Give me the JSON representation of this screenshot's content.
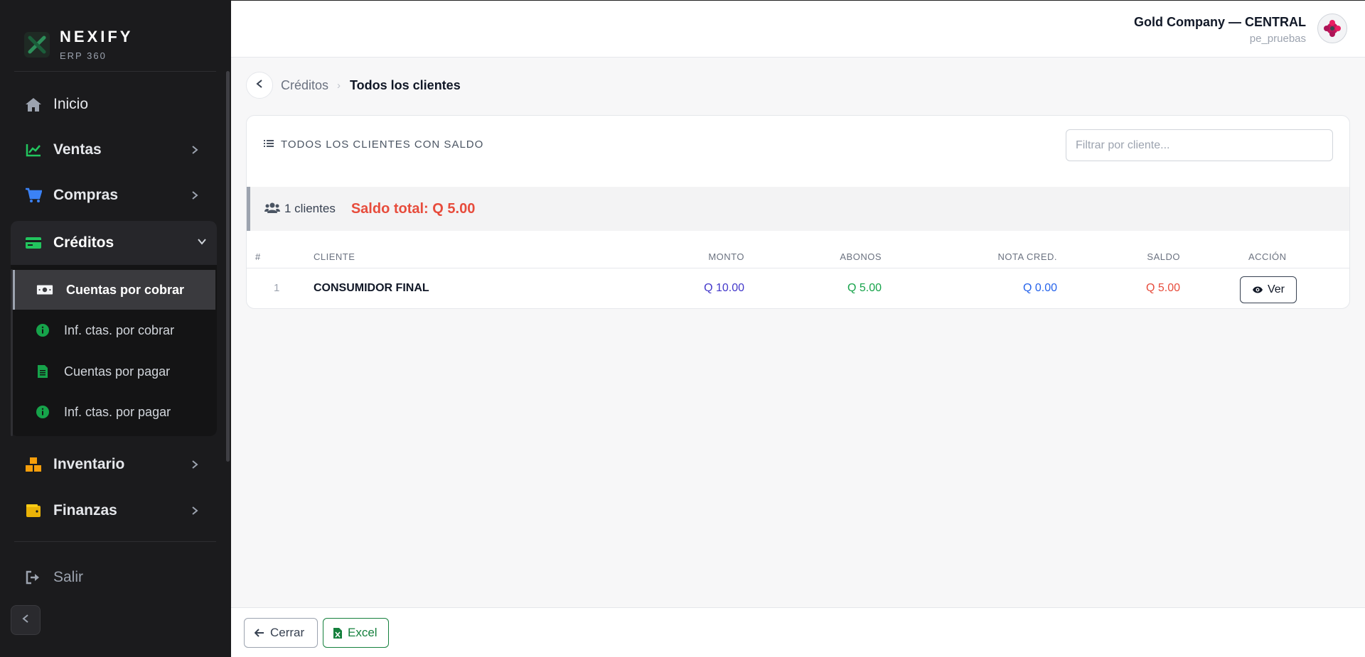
{
  "brand": {
    "name": "NEXIFY",
    "sub": "ERP 360"
  },
  "sidebar": {
    "items": [
      {
        "label": "Inicio",
        "icon": "home-icon"
      },
      {
        "label": "Ventas",
        "icon": "chart-line-icon"
      },
      {
        "label": "Compras",
        "icon": "cart-icon"
      },
      {
        "label": "Créditos",
        "icon": "credit-card-icon"
      },
      {
        "label": "Inventario",
        "icon": "boxes-icon"
      },
      {
        "label": "Finanzas",
        "icon": "wallet-icon"
      }
    ],
    "credits_sub": [
      {
        "label": "Cuentas por cobrar",
        "icon": "money-bill-icon",
        "active": true
      },
      {
        "label": "Inf. ctas. por cobrar",
        "icon": "info-circle-icon"
      },
      {
        "label": "Cuentas por pagar",
        "icon": "file-invoice-icon"
      },
      {
        "label": "Inf. ctas. por pagar",
        "icon": "info-circle-icon"
      }
    ],
    "logout": {
      "label": "Salir",
      "icon": "sign-out-icon"
    }
  },
  "header": {
    "company": "Gold Company — CENTRAL",
    "user": "pe_pruebas"
  },
  "breadcrumb": {
    "parent": "Créditos",
    "current": "Todos los clientes"
  },
  "card": {
    "title": "TODOS LOS CLIENTES CON SALDO",
    "filter_placeholder": "Filtrar por cliente..."
  },
  "summary": {
    "count_text": "1 clientes",
    "total_text": "Saldo total: Q 5.00"
  },
  "table": {
    "headers": [
      "#",
      "CLIENTE",
      "MONTO",
      "ABONOS",
      "NOTA CRED.",
      "SALDO",
      "ACCIÓN"
    ],
    "rows": [
      {
        "num": "1",
        "cliente": "CONSUMIDOR FINAL",
        "monto": "Q 10.00",
        "abonos": "Q 5.00",
        "nota": "Q 0.00",
        "saldo": "Q 5.00",
        "accion": "Ver"
      }
    ]
  },
  "footer": {
    "close_label": "Cerrar",
    "excel_label": "Excel"
  },
  "colors": {
    "accent_green": "#22c55e",
    "accent_blue": "#3b82f6",
    "monto": "#4338ca",
    "abonos": "#16a34a",
    "nota": "#2563eb",
    "saldo": "#e74c3c"
  }
}
